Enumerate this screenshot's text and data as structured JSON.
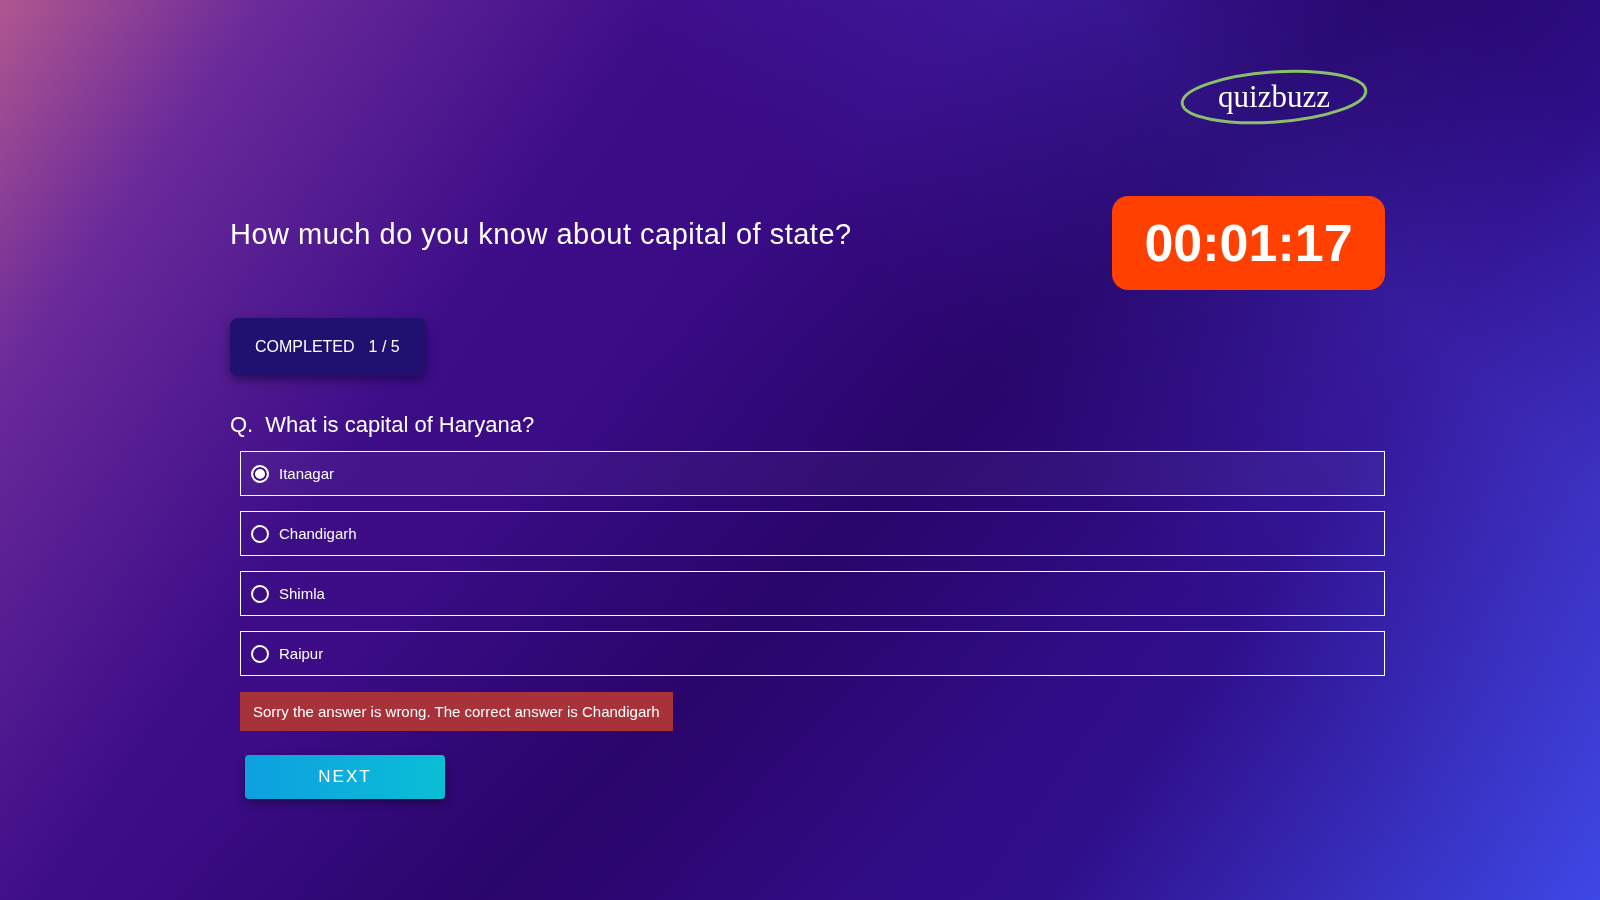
{
  "logo": {
    "text": "quizbuzz"
  },
  "quiz": {
    "title": "How much do you know about capital of state?",
    "timer": "00:01:17"
  },
  "progress": {
    "label": "COMPLETED",
    "count": "1 / 5"
  },
  "question": {
    "prefix": "Q.",
    "text": "What is capital of Haryana?"
  },
  "options": [
    {
      "label": "Itanagar",
      "selected": true
    },
    {
      "label": "Chandigarh",
      "selected": false
    },
    {
      "label": "Shimla",
      "selected": false
    },
    {
      "label": "Raipur",
      "selected": false
    }
  ],
  "feedback": {
    "text": "Sorry the answer is wrong. The correct answer is Chandigarh",
    "kind": "error"
  },
  "buttons": [
    {
      "label": "NEXT"
    }
  ]
}
